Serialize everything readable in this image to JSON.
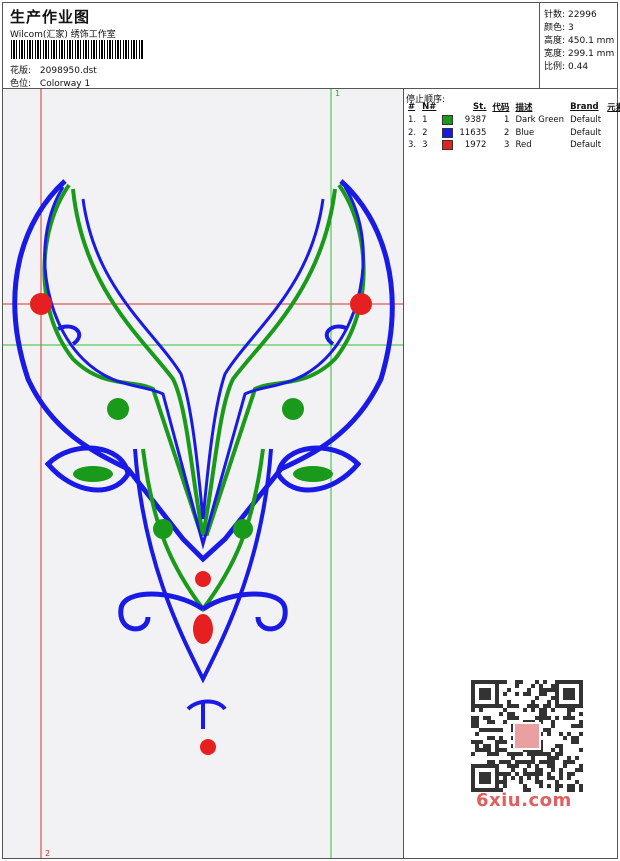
{
  "header": {
    "title": "生产作业图",
    "studio": "Wilcom(汇家) 绣饰工作室",
    "file_label": "花版:",
    "file_name": "2098950.dst",
    "colorway_label": "色位:",
    "colorway_name": "Colorway 1"
  },
  "specs": [
    {
      "label": "针数:",
      "value": "22996"
    },
    {
      "label": "颜色:",
      "value": "3"
    },
    {
      "label": "高度:",
      "value": "450.1 mm"
    },
    {
      "label": "宽度:",
      "value": "299.1 mm"
    },
    {
      "label": "比例:",
      "value": "0.44"
    }
  ],
  "stop_sequence": {
    "title": "停止顺序:",
    "columns": [
      "#",
      "N#",
      "St.",
      "代码",
      "描述",
      "Brand",
      "元素"
    ],
    "rows": [
      {
        "idx": "1.",
        "n": "1",
        "stitches": "9387",
        "code": "1",
        "desc": "Dark Green",
        "brand": "Default",
        "color": "#1a9a1a"
      },
      {
        "idx": "2.",
        "n": "2",
        "stitches": "11635",
        "code": "2",
        "desc": "Blue",
        "brand": "Default",
        "color": "#1a1ae6"
      },
      {
        "idx": "3.",
        "n": "3",
        "stitches": "1972",
        "code": "3",
        "desc": "Red",
        "brand": "Default",
        "color": "#e62020"
      }
    ]
  },
  "guides": {
    "label_top": "1",
    "label_bottom": "2"
  },
  "watermark": {
    "site": "6xiu.com"
  },
  "colors": {
    "green": "#1a9a1a",
    "blue": "#1a1ae6",
    "red": "#e62020",
    "guide_red": "#e03030",
    "guide_green": "#30c030"
  }
}
